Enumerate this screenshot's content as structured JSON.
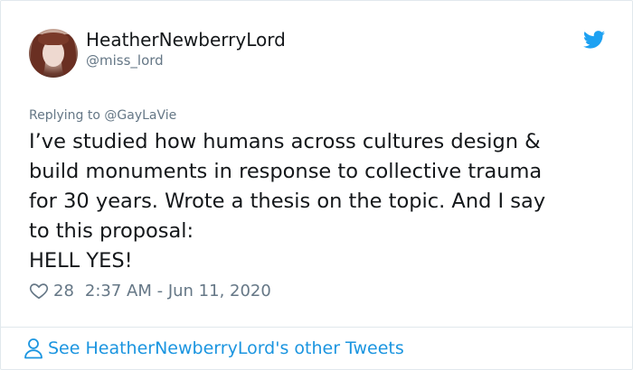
{
  "tweet": {
    "display_name": "HeatherNewberryLord",
    "handle": "@miss_lord",
    "reply_prefix": "Replying to ",
    "reply_to": "@GayLaVie",
    "text_lines": [
      "I’ve studied how humans across cultures design &",
      "build monuments in response to collective trauma",
      "for 30 years. Wrote a thesis on the topic. And I say",
      "to this proposal:",
      "HELL YES!"
    ],
    "likes": "28",
    "timestamp": "2:37 AM - Jun 11, 2020"
  },
  "footer": {
    "link_text": "See HeatherNewberryLord's other Tweets"
  },
  "icons": {
    "brand": "twitter-bird-icon",
    "like": "heart-icon",
    "profile": "person-icon"
  },
  "colors": {
    "brand_blue": "#1da1f2",
    "link_blue": "#1b95e0",
    "secondary_text": "#657786",
    "primary_text": "#14171a",
    "border": "#e1e8ed"
  }
}
